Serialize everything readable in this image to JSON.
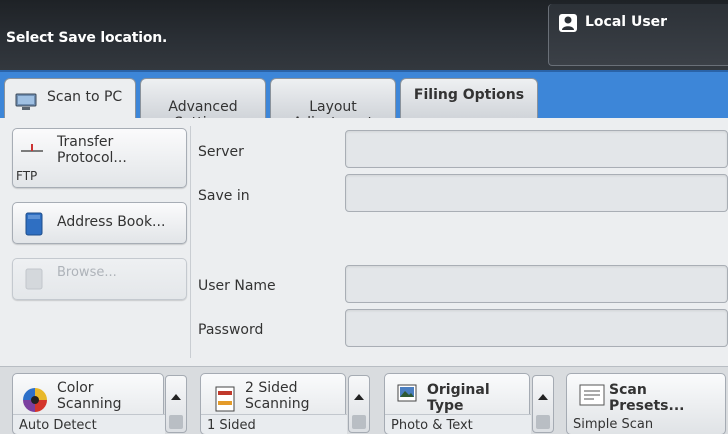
{
  "header": {
    "message": "Select Save location.",
    "user_label": "Local User",
    "user_icon": "user-icon"
  },
  "tabs": [
    {
      "label": "Scan to PC",
      "active": true,
      "icon": "pc-icon"
    },
    {
      "label": "Advanced\nSettings",
      "active": false
    },
    {
      "label": "Layout\nAdjustment",
      "active": false
    },
    {
      "label": "Filing Options",
      "active": false
    }
  ],
  "side_buttons": {
    "transfer_protocol": {
      "label": "Transfer\nProtocol...",
      "value": "FTP",
      "icon": "protocol-icon"
    },
    "address_book": {
      "label": "Address Book...",
      "icon": "address-book-icon"
    },
    "browse": {
      "label": "Browse...",
      "icon": "browse-icon",
      "enabled": false
    }
  },
  "fields": {
    "server": {
      "label": "Server",
      "value": ""
    },
    "save_in": {
      "label": "Save in",
      "value": ""
    },
    "user_name": {
      "label": "User Name",
      "value": ""
    },
    "password": {
      "label": "Password",
      "value": ""
    }
  },
  "features": {
    "color_scanning": {
      "label": "Color\nScanning",
      "value": "Auto Detect",
      "icon": "color-wheel-icon"
    },
    "two_sided": {
      "label": "2 Sided\nScanning",
      "value": "1 Sided",
      "icon": "duplex-icon"
    },
    "original_type": {
      "label": "Original Type",
      "value": "Photo & Text",
      "icon": "photo-icon"
    },
    "scan_presets": {
      "label": "Scan Presets...",
      "value": "Simple Scan",
      "icon": "presets-icon"
    }
  },
  "colors": {
    "tab_bar": "#3d86d8",
    "header_bg": "#2b3036"
  }
}
